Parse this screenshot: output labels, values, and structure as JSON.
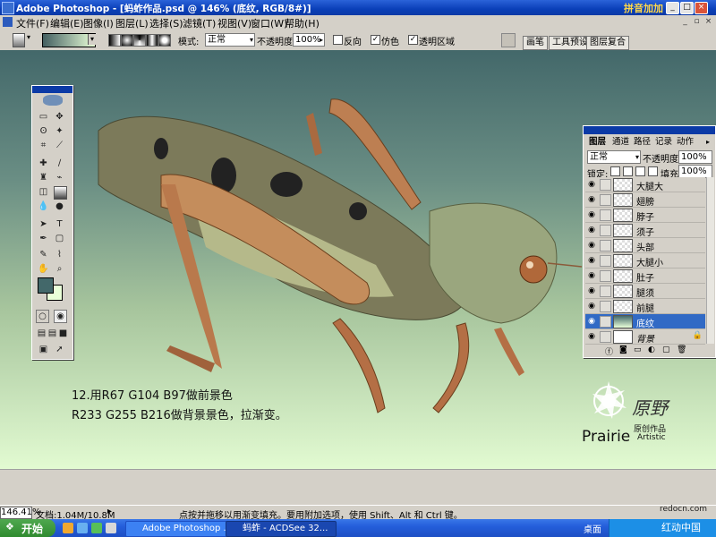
{
  "window": {
    "title": "Adobe Photoshop - [蚂蚱作品.psd @ 146% (底纹, RGB/8#)]",
    "brand": "拼音加加"
  },
  "menu": [
    "文件(F)",
    "编辑(E)",
    "图像(I)",
    "图层(L)",
    "选择(S)",
    "滤镜(T)",
    "视图(V)",
    "窗口(W)",
    "帮助(H)"
  ],
  "options": {
    "mode_label": "模式:",
    "mode_value": "正常",
    "opacity_label": "不透明度:",
    "opacity_value": "100%",
    "reverse_label": "反向",
    "reverse_checked": false,
    "dither_label": "仿色",
    "dither_checked": true,
    "transparency_label": "透明区域",
    "transparency_checked": true,
    "well_tabs": [
      "画笔",
      "工具预设",
      "图层复合"
    ],
    "gradient_colors": [
      "#435f61",
      "#e9ffd8"
    ]
  },
  "canvas": {
    "gradient_top": "#43686a",
    "gradient_bottom": "#e7ffd6",
    "instruction_line1": "12.用R67 G104 B97做前景色",
    "instruction_line2": "R233 G255 B216做背景景色，拉渐变。",
    "logo_calligraphy": "原野",
    "logo_brand": "Prairie",
    "logo_sub_cn": "原创作品",
    "logo_sub_en": "Artistic"
  },
  "toolbox": {
    "foreground": "#43686a",
    "background": "#e9ffd8"
  },
  "layers_panel": {
    "tabs": [
      "图层",
      "通道",
      "路径",
      "记录",
      "动作"
    ],
    "blend_mode": "正常",
    "opacity_label": "不透明度:",
    "opacity_value": "100%",
    "lock_label": "锁定:",
    "fill_label": "填充:",
    "fill_value": "100%",
    "layers": [
      {
        "name": "大腿大",
        "selected": false
      },
      {
        "name": "翅膀",
        "selected": false
      },
      {
        "name": "脖子",
        "selected": false
      },
      {
        "name": "须子",
        "selected": false
      },
      {
        "name": "头部",
        "selected": false
      },
      {
        "name": "大腿小",
        "selected": false
      },
      {
        "name": "肚子",
        "selected": false
      },
      {
        "name": "腿须",
        "selected": false
      },
      {
        "name": "前腿",
        "selected": false
      },
      {
        "name": "底纹",
        "selected": true
      },
      {
        "name": "背景",
        "selected": false
      }
    ]
  },
  "status": {
    "zoom": "146.41%",
    "doc_size": "文档:1.04M/10.8M",
    "hint": "点按并拖移以用渐变填充。要用附加选项，使用 Shift、Alt 和 Ctrl 键。"
  },
  "taskbar": {
    "start_label": "开始",
    "tasks": [
      "Adobe Photoshop ...",
      "蚂蚱 - ACDSee 32..."
    ],
    "tray_label": "桌面",
    "watermark_url": "redocn.com",
    "watermark_text": "红动中国"
  }
}
